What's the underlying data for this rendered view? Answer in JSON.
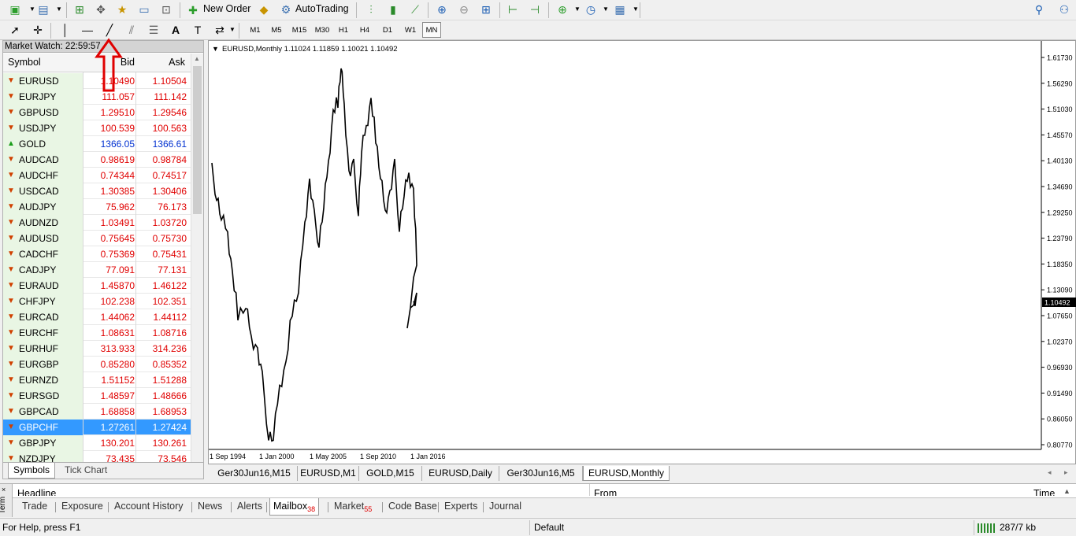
{
  "toolbar": {
    "new_order_label": "New Order",
    "autotrading_label": "AutoTrading",
    "timeframes": [
      "M1",
      "M5",
      "M15",
      "M30",
      "H1",
      "H4",
      "D1",
      "W1",
      "MN"
    ],
    "active_timeframe": "MN"
  },
  "market_watch": {
    "title": "Market Watch: 22:59:57",
    "columns": {
      "symbol": "Symbol",
      "bid": "Bid",
      "ask": "Ask"
    },
    "rows": [
      {
        "symbol": "EURUSD",
        "bid": "1.10490",
        "ask": "1.10504",
        "dir": "down"
      },
      {
        "symbol": "EURJPY",
        "bid": "111.057",
        "ask": "111.142",
        "dir": "down"
      },
      {
        "symbol": "GBPUSD",
        "bid": "1.29510",
        "ask": "1.29546",
        "dir": "down"
      },
      {
        "symbol": "USDJPY",
        "bid": "100.539",
        "ask": "100.563",
        "dir": "down"
      },
      {
        "symbol": "GOLD",
        "bid": "1366.05",
        "ask": "1366.61",
        "dir": "up"
      },
      {
        "symbol": "AUDCAD",
        "bid": "0.98619",
        "ask": "0.98784",
        "dir": "down"
      },
      {
        "symbol": "AUDCHF",
        "bid": "0.74344",
        "ask": "0.74517",
        "dir": "down"
      },
      {
        "symbol": "USDCAD",
        "bid": "1.30385",
        "ask": "1.30406",
        "dir": "down"
      },
      {
        "symbol": "AUDJPY",
        "bid": "75.962",
        "ask": "76.173",
        "dir": "down"
      },
      {
        "symbol": "AUDNZD",
        "bid": "1.03491",
        "ask": "1.03720",
        "dir": "down"
      },
      {
        "symbol": "AUDUSD",
        "bid": "0.75645",
        "ask": "0.75730",
        "dir": "down"
      },
      {
        "symbol": "CADCHF",
        "bid": "0.75369",
        "ask": "0.75431",
        "dir": "down"
      },
      {
        "symbol": "CADJPY",
        "bid": "77.091",
        "ask": "77.131",
        "dir": "down"
      },
      {
        "symbol": "EURAUD",
        "bid": "1.45870",
        "ask": "1.46122",
        "dir": "down"
      },
      {
        "symbol": "CHFJPY",
        "bid": "102.238",
        "ask": "102.351",
        "dir": "down"
      },
      {
        "symbol": "EURCAD",
        "bid": "1.44062",
        "ask": "1.44112",
        "dir": "down"
      },
      {
        "symbol": "EURCHF",
        "bid": "1.08631",
        "ask": "1.08716",
        "dir": "down"
      },
      {
        "symbol": "EURHUF",
        "bid": "313.933",
        "ask": "314.236",
        "dir": "down"
      },
      {
        "symbol": "EURGBP",
        "bid": "0.85280",
        "ask": "0.85352",
        "dir": "down"
      },
      {
        "symbol": "EURNZD",
        "bid": "1.51152",
        "ask": "1.51288",
        "dir": "down"
      },
      {
        "symbol": "EURSGD",
        "bid": "1.48597",
        "ask": "1.48666",
        "dir": "down"
      },
      {
        "symbol": "GBPCAD",
        "bid": "1.68858",
        "ask": "1.68953",
        "dir": "down"
      },
      {
        "symbol": "GBPCHF",
        "bid": "1.27261",
        "ask": "1.27424",
        "dir": "down",
        "selected": true
      },
      {
        "symbol": "GBPJPY",
        "bid": "130.201",
        "ask": "130.261",
        "dir": "down"
      },
      {
        "symbol": "NZDJPY",
        "bid": "73.435",
        "ask": "73.546",
        "dir": "down"
      }
    ],
    "tabs": [
      "Symbols",
      "Tick Chart"
    ],
    "active_tab": "Symbols"
  },
  "chart": {
    "header": "EURUSD,Monthly  1.11024 1.11859 1.10021 1.10492",
    "price_labels": [
      "1.61730",
      "1.56290",
      "1.51030",
      "1.45570",
      "1.40130",
      "1.34690",
      "1.29250",
      "1.23790",
      "1.18350",
      "1.13090",
      "1.07650",
      "1.02370",
      "0.96930",
      "0.91490",
      "0.86050",
      "0.80770"
    ],
    "current_price": "1.10492",
    "date_labels": [
      "1 Sep 1994",
      "1 Jan 2000",
      "1 May 2005",
      "1 Sep 2010",
      "1 Jan 2016"
    ]
  },
  "chart_tabs": [
    "Ger30Jun16,M15",
    "EURUSD,M1",
    "GOLD,M15",
    "EURUSD,Daily",
    "Ger30Jun16,M5",
    "EURUSD,Monthly"
  ],
  "active_chart_tab": "EURUSD,Monthly",
  "terminal": {
    "side_label": "Term",
    "columns": {
      "headline": "Headline",
      "from": "From",
      "time": "Time"
    },
    "tabs": [
      {
        "label": "Trade",
        "badge": ""
      },
      {
        "label": "Exposure",
        "badge": ""
      },
      {
        "label": "Account History",
        "badge": ""
      },
      {
        "label": "News",
        "badge": ""
      },
      {
        "label": "Alerts",
        "badge": ""
      },
      {
        "label": "Mailbox",
        "badge": "38"
      },
      {
        "label": "Market",
        "badge": "55"
      },
      {
        "label": "Code Base",
        "badge": ""
      },
      {
        "label": "Experts",
        "badge": ""
      },
      {
        "label": "Journal",
        "badge": ""
      }
    ],
    "active_tab": "Mailbox"
  },
  "status_bar": {
    "help": "For Help, press F1",
    "profile": "Default",
    "traffic": "287/7 kb"
  },
  "colors": {
    "bid_down": "#e00000",
    "bid_up": "#0030d0",
    "selection": "#3399ff",
    "annotation_arrow": "#e00000"
  }
}
